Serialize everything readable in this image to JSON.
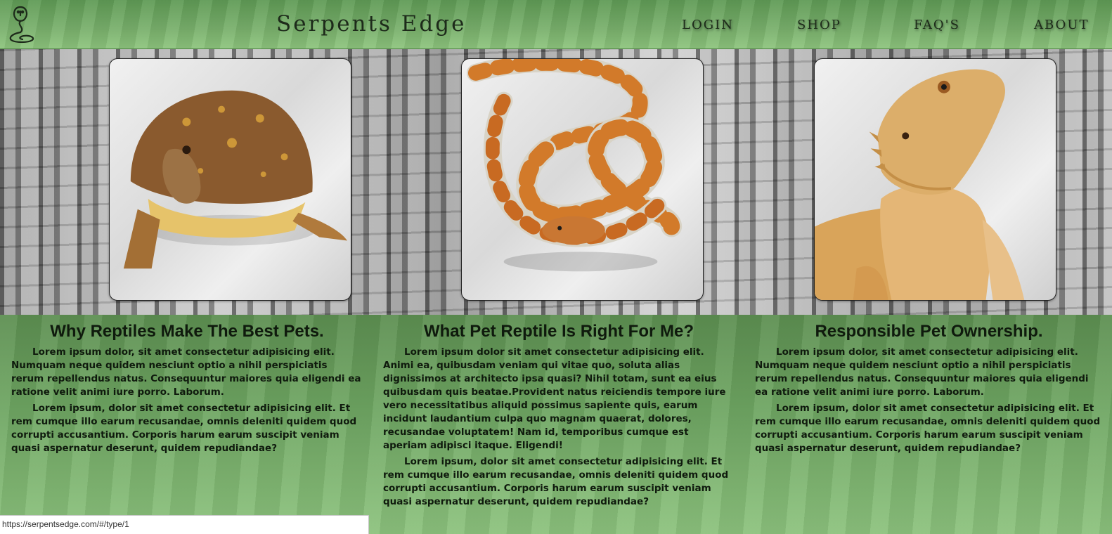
{
  "header": {
    "logo_icon": "cobra-icon",
    "title": "Serpents Edge",
    "nav": [
      {
        "label": "LOGIN"
      },
      {
        "label": "SHOP"
      },
      {
        "label": "FAQ'S"
      },
      {
        "label": "ABOUT"
      }
    ]
  },
  "gallery": {
    "images": [
      {
        "subject": "box-turtle"
      },
      {
        "subject": "corn-snake"
      },
      {
        "subject": "bearded-dragon"
      }
    ]
  },
  "sections": [
    {
      "title": "Why Reptiles Make The Best Pets.",
      "paragraphs": [
        "Lorem ipsum dolor, sit amet consectetur adipisicing elit. Numquam neque quidem nesciunt optio a nihil perspiciatis rerum repellendus natus. Consequuntur maiores quia eligendi ea ratione velit animi iure porro. Laborum.",
        "Lorem ipsum, dolor sit amet consectetur adipisicing elit. Et rem cumque illo earum recusandae, omnis deleniti quidem quod corrupti accusantium. Corporis harum earum suscipit veniam quasi aspernatur deserunt, quidem repudiandae?"
      ]
    },
    {
      "title": "What Pet Reptile Is Right For Me?",
      "paragraphs": [
        "Lorem ipsum dolor sit amet consectetur adipisicing elit. Animi ea, quibusdam veniam qui vitae quo, soluta alias dignissimos at architecto ipsa quasi? Nihil totam, sunt ea eius quibusdam quis beatae.Provident natus reiciendis tempore iure vero necessitatibus aliquid possimus sapiente quis, earum incidunt laudantium culpa quo magnam quaerat, dolores, recusandae voluptatem! Nam id, temporibus cumque est aperiam adipisci itaque. Eligendi!",
        "Lorem ipsum, dolor sit amet consectetur adipisicing elit. Et rem cumque illo earum recusandae, omnis deleniti quidem quod corrupti accusantium. Corporis harum earum suscipit veniam quasi aspernatur deserunt, quidem repudiandae?"
      ]
    },
    {
      "title": "Responsible Pet Ownership.",
      "paragraphs": [
        "Lorem ipsum dolor, sit amet consectetur adipisicing elit. Numquam neque quidem nesciunt optio a nihil perspiciatis rerum repellendus natus. Consequuntur maiores quia eligendi ea ratione velit animi iure porro. Laborum.",
        "Lorem ipsum, dolor sit amet consectetur adipisicing elit. Et rem cumque illo earum recusandae, omnis deleniti quidem quod corrupti accusantium. Corporis harum earum suscipit veniam quasi aspernatur deserunt, quidem repudiandae?"
      ]
    }
  ],
  "status_bar": {
    "url": "https://serpentsedge.com/#/type/1"
  },
  "colors": {
    "header_green": "#79b06c",
    "content_green": "#6da461",
    "text_dark": "#0f1a0d"
  }
}
